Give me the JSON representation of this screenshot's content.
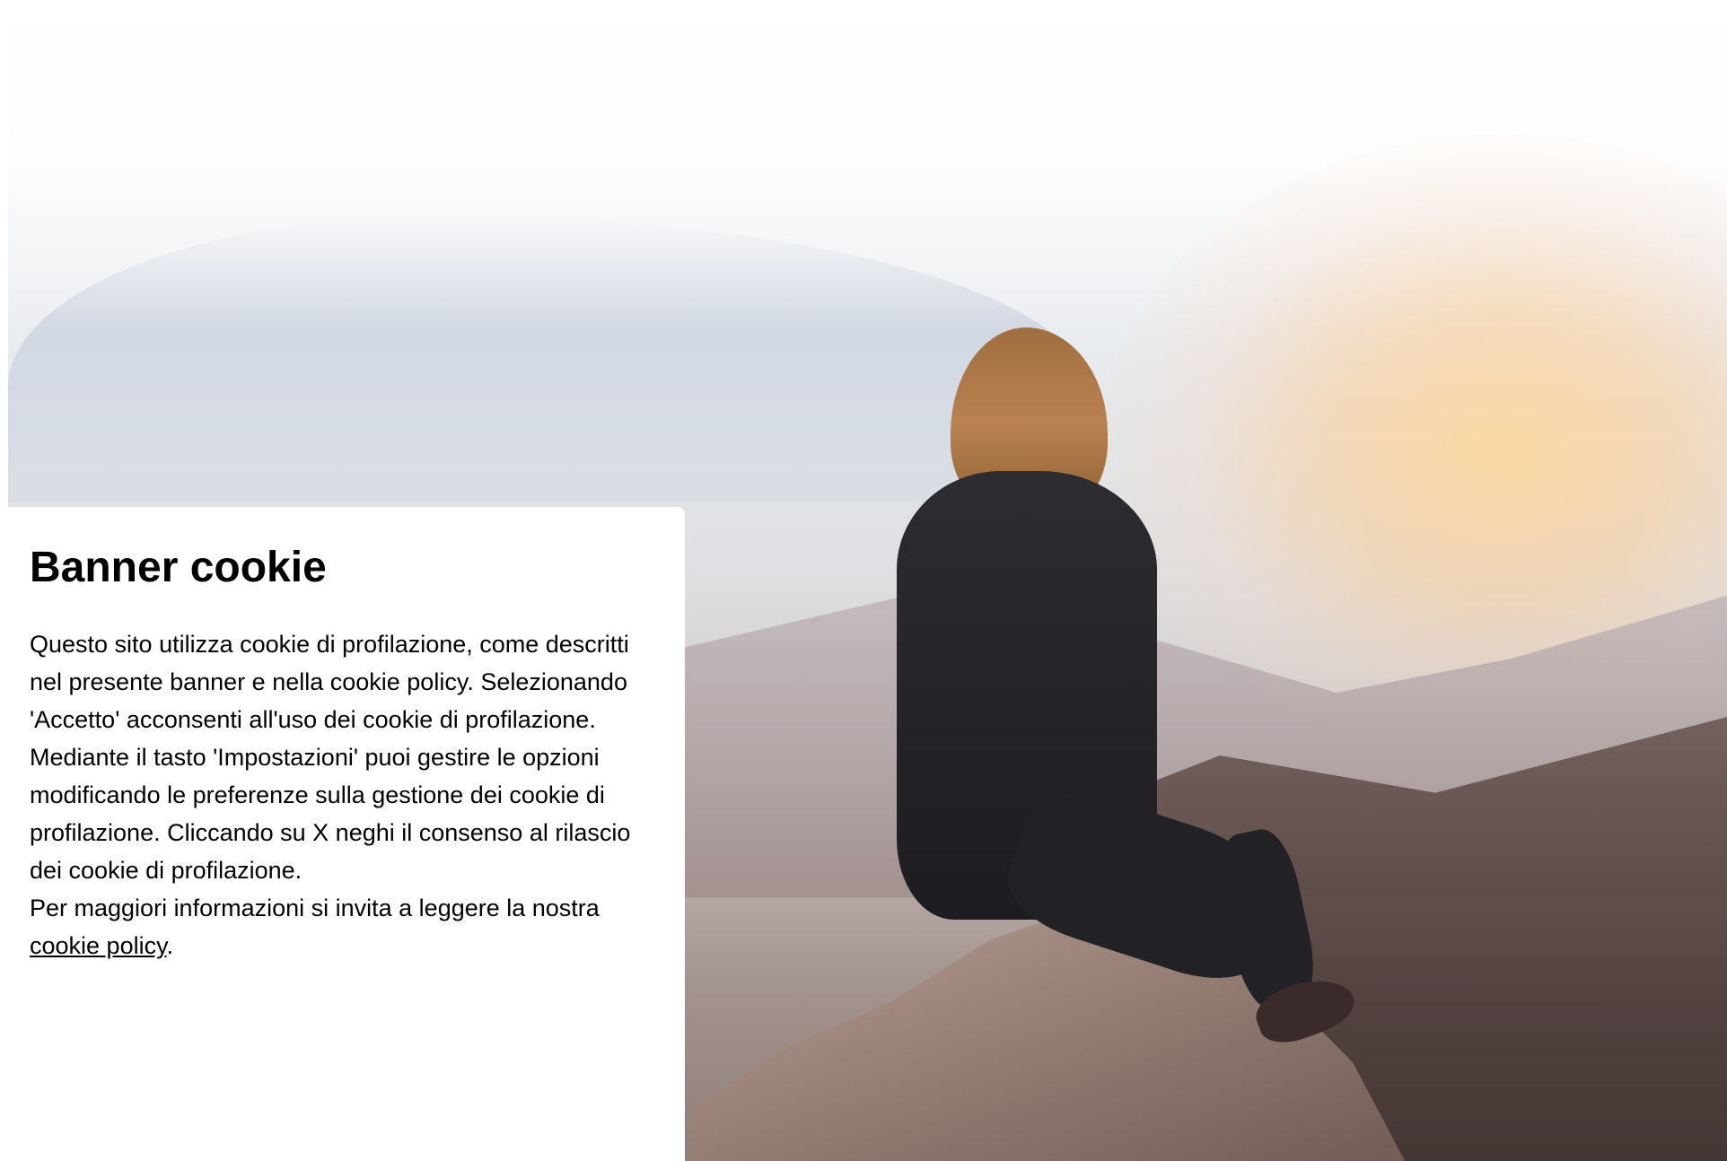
{
  "banner": {
    "title": "Banner cookie",
    "paragraph_main": "Questo sito utilizza cookie di profilazione, come descritti nel presente banner e nella cookie policy. Selezionando 'Accetto' acconsenti all'uso dei cookie di profilazione. Mediante il tasto 'Impostazioni' puoi gestire le opzioni modificando le preferenze sulla gestione dei cookie di profilazione. Cliccando su X neghi il consenso al rilascio dei cookie di profilazione.",
    "paragraph_more_prefix": "Per maggiori informazioni si invita a leggere la nostra ",
    "policy_link_label": "cookie policy",
    "paragraph_more_suffix": "."
  },
  "colors": {
    "banner_background": "#ffffff",
    "text": "#000000"
  }
}
